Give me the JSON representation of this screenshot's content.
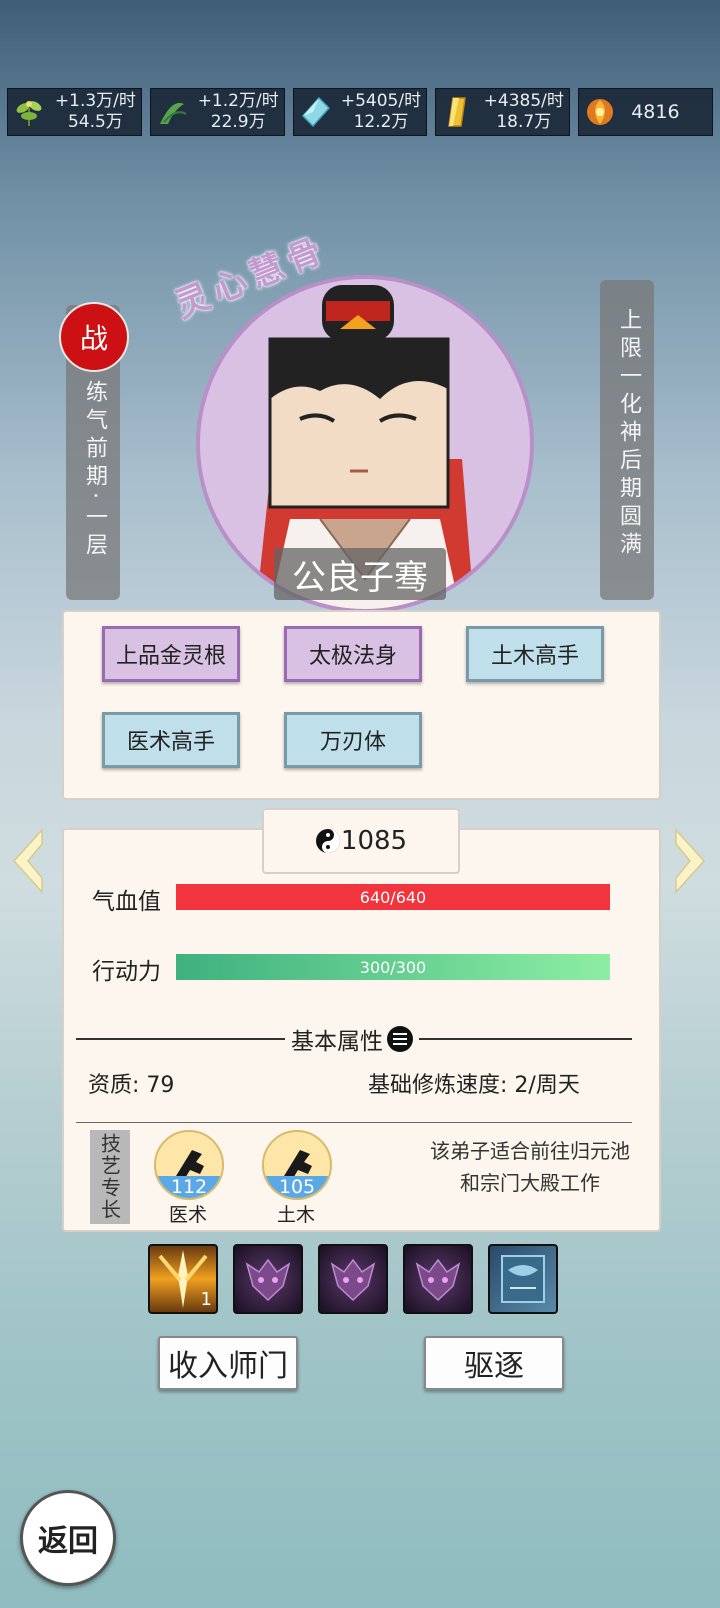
{
  "resources": [
    {
      "icon": "herb-icon",
      "rate": "+1.3万/时",
      "total": "54.5万"
    },
    {
      "icon": "grass-icon",
      "rate": "+1.2万/时",
      "total": "22.9万"
    },
    {
      "icon": "crystal-icon",
      "rate": "+5405/时",
      "total": "12.2万"
    },
    {
      "icon": "gold-bar-icon",
      "rate": "+4385/时",
      "total": "18.7万"
    },
    {
      "icon": "fire-coin-icon",
      "value": "4816"
    }
  ],
  "character": {
    "title": "灵心慧骨",
    "name": "公良子骞",
    "battle_badge": "战",
    "realm": "练气前期·一层",
    "limit": "上限一化神后期圆满"
  },
  "traits": [
    {
      "label": "上品金灵根",
      "tier": "purple"
    },
    {
      "label": "太极法身",
      "tier": "purple"
    },
    {
      "label": "土木高手",
      "tier": "blue"
    },
    {
      "label": "医术高手",
      "tier": "blue"
    },
    {
      "label": "万刃体",
      "tier": "blue"
    }
  ],
  "power": "1085",
  "stats": {
    "hp_label": "气血值",
    "hp_value": "640/640",
    "hp_fill": 1.0,
    "ap_label": "行动力",
    "ap_value": "300/300",
    "ap_fill": 1.0
  },
  "basic": {
    "section_title": "基本属性",
    "aptitude": "资质: 79",
    "speed": "基础修炼速度:  2/周天"
  },
  "skills": {
    "tag": "技艺专长",
    "items": [
      {
        "value": "112",
        "label": "医术"
      },
      {
        "value": "105",
        "label": "土木"
      }
    ],
    "hint": "该弟子适合前往归元池和宗门大殿工作"
  },
  "equip": [
    {
      "icon": "golden-blade-icon",
      "count": "1"
    },
    {
      "icon": "purple-dragon-icon"
    },
    {
      "icon": "purple-dragon-icon"
    },
    {
      "icon": "purple-dragon-icon"
    },
    {
      "icon": "blue-scroll-icon"
    }
  ],
  "buttons": {
    "recruit": "收入师门",
    "expel": "驱逐",
    "back": "返回"
  },
  "colors": {
    "hp": "#f2343e",
    "ap": "#5fd493",
    "purple": "#d9c1e3",
    "blue": "#bfe0ea",
    "badge": "#cc1014"
  }
}
